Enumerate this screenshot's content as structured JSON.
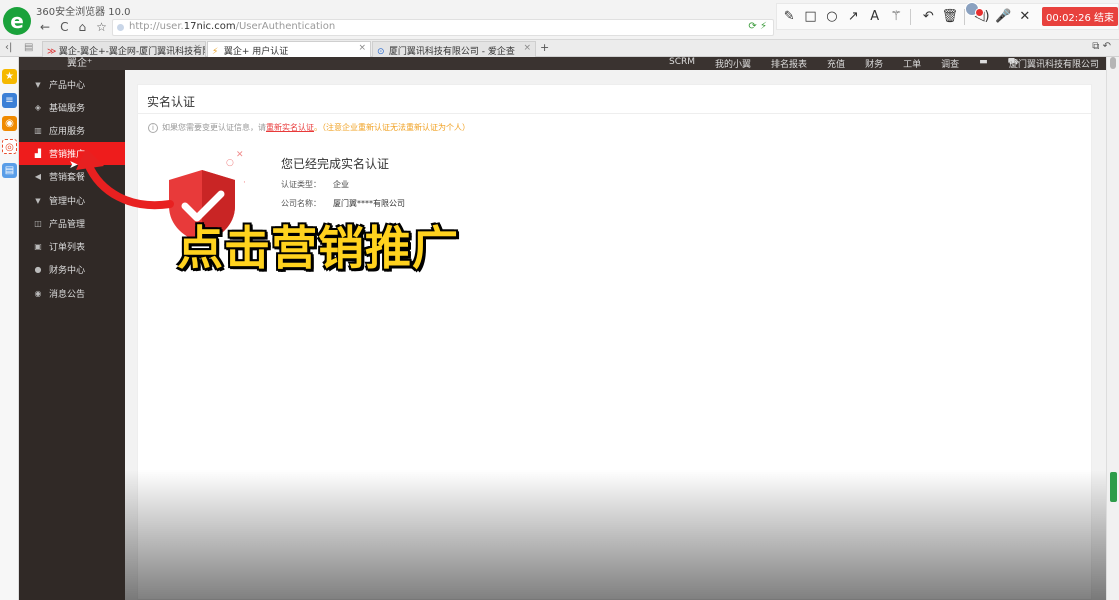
{
  "browser": {
    "title": "360安全浏览器 10.0",
    "url_prefix": "http://user.",
    "url_domain": "17nic.com",
    "url_path": "/UserAuthentication"
  },
  "recorder": {
    "timer": "00:02:26 结束"
  },
  "tabs": [
    {
      "label": "翼企-翼企+-翼企网-厦门翼讯科技有限",
      "favicon": "≫"
    },
    {
      "label": "翼企+ 用户认证",
      "favicon": "⚡"
    },
    {
      "label": "厦门翼讯科技有限公司 - 爱企查",
      "favicon": "⊙"
    }
  ],
  "header": {
    "logo": "翼企⁺",
    "links": [
      "SCRM",
      "我的小翼",
      "排名报表",
      "充值",
      "财务",
      "工单",
      "调查"
    ],
    "company": "厦门翼讯科技有限公司"
  },
  "sidebar": {
    "items": [
      {
        "label": "产品中心",
        "icon": "caret-down-icon",
        "glyph": "▼",
        "group": true
      },
      {
        "label": "基础服务",
        "icon": "box-icon",
        "glyph": "◈",
        "group": false
      },
      {
        "label": "应用服务",
        "icon": "building-icon",
        "glyph": "▥",
        "group": false
      },
      {
        "label": "营销推广",
        "icon": "chart-icon",
        "glyph": "▟",
        "group": false,
        "active": true
      },
      {
        "label": "营销套餐",
        "icon": "megaphone-icon",
        "glyph": "◀",
        "group": false
      },
      {
        "label": "管理中心",
        "icon": "caret-down-icon",
        "glyph": "▼",
        "group": true
      },
      {
        "label": "产品管理",
        "icon": "box-manage-icon",
        "glyph": "◫",
        "group": false
      },
      {
        "label": "订单列表",
        "icon": "lock-icon",
        "glyph": "▣",
        "group": false
      },
      {
        "label": "财务中心",
        "icon": "money-bag-icon",
        "glyph": "●",
        "group": false
      },
      {
        "label": "消息公告",
        "icon": "globe-icon",
        "glyph": "◉",
        "group": false
      }
    ]
  },
  "content": {
    "title": "实名认证",
    "notice_prefix": "如果您需要变更认证信息，请",
    "notice_link": "重新实名认证",
    "notice_suffix": "。（注意企业重新认证无法重新认证为个人）",
    "verified_title": "您已经完成实名认证",
    "type_label": "认证类型：",
    "type_value": "企业",
    "company_label": "公司名称：",
    "company_value": "厦门翼****有限公司"
  },
  "overlay": {
    "caption": "点击营销推广"
  },
  "colors": {
    "accent": "#ee1c1c",
    "sidebar_bg": "#302926",
    "caption": "#ffd21e"
  }
}
